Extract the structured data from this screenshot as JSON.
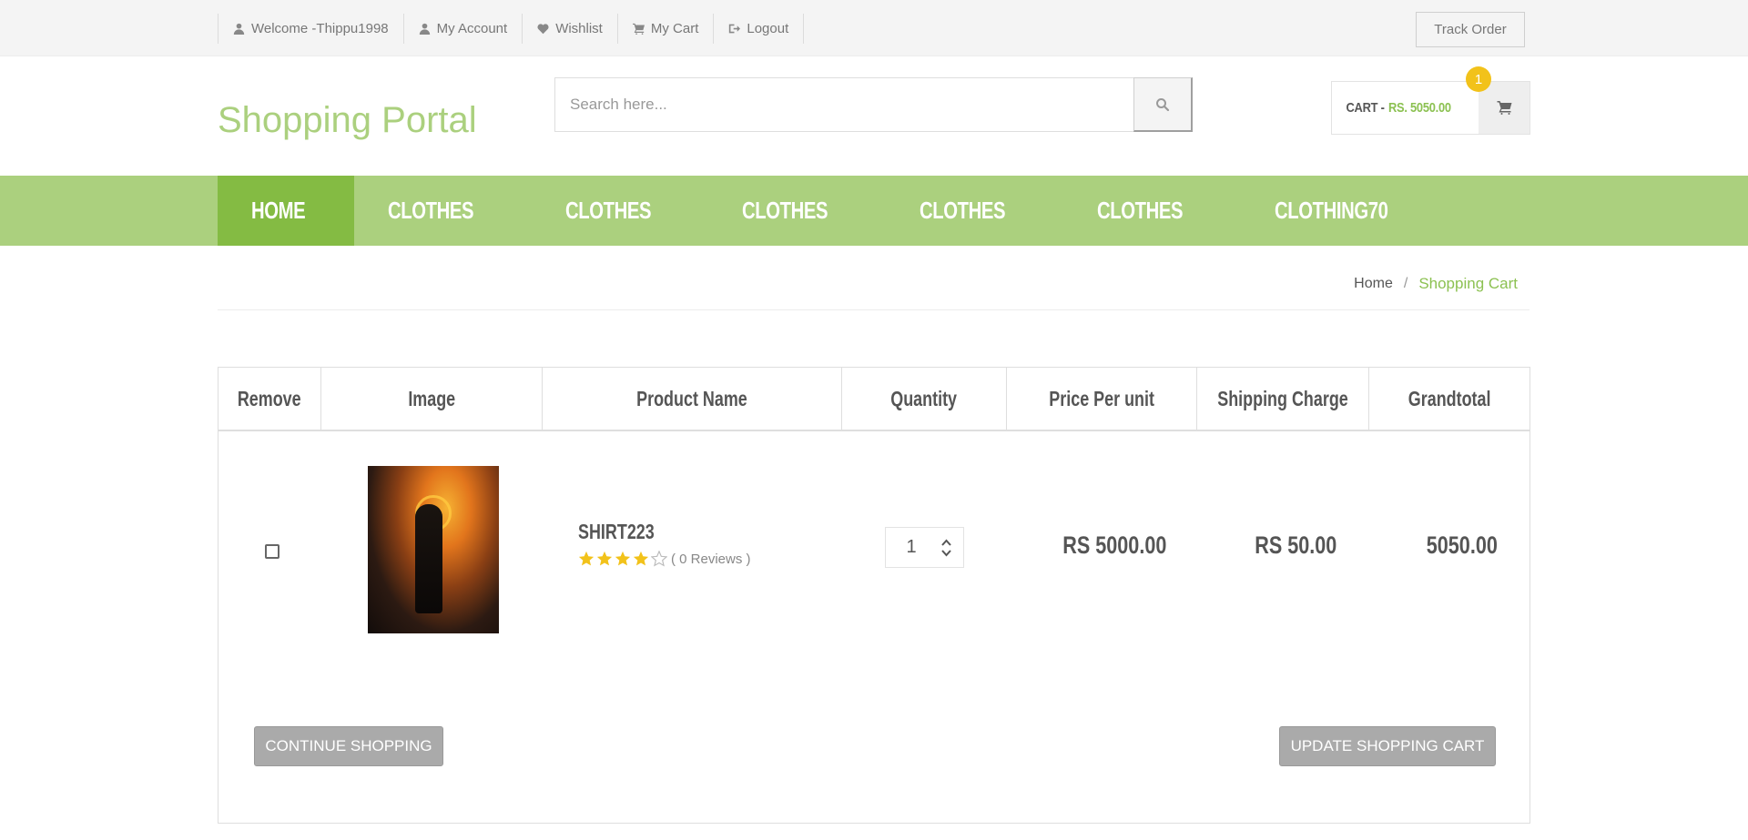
{
  "topbar": {
    "links": [
      {
        "label": "Welcome -Thippu1998",
        "icon": "user-icon"
      },
      {
        "label": "My Account",
        "icon": "user-icon"
      },
      {
        "label": "Wishlist",
        "icon": "heart-icon"
      },
      {
        "label": "My Cart",
        "icon": "cart-icon"
      },
      {
        "label": "Logout",
        "icon": "logout-icon"
      }
    ],
    "track_order": "Track Order"
  },
  "header": {
    "logo": "Shopping Portal",
    "search_placeholder": "Search here...",
    "cart_label": "CART -",
    "cart_total": "RS. 5050.00",
    "cart_count": "1"
  },
  "nav": {
    "items": [
      "HOME",
      "CLOTHES",
      "CLOTHES",
      "CLOTHES",
      "CLOTHES",
      "CLOTHES",
      "CLOTHING70"
    ],
    "active": "HOME"
  },
  "breadcrumb": {
    "home": "Home",
    "separator": "/",
    "current": "Shopping Cart"
  },
  "table": {
    "headers": [
      "Remove",
      "Image",
      "Product Name",
      "Quantity",
      "Price Per unit",
      "Shipping Charge",
      "Grandtotal"
    ],
    "rows": [
      {
        "product_name": "SHIRT223",
        "rating": 4,
        "rating_max": 5,
        "reviews": "( 0 Reviews )",
        "quantity": "1",
        "price_per_unit": "RS 5000.00",
        "shipping_charge": "RS 50.00",
        "grandtotal": "5050.00"
      }
    ]
  },
  "buttons": {
    "continue_shopping": "CONTINUE SHOPPING",
    "update_cart": "UPDATE SHOPPING CART"
  },
  "colors": {
    "brand_green": "#abd07e",
    "active_green": "#84bb43",
    "price_green": "#8cc152",
    "badge_yellow": "#f2c21a",
    "star_yellow": "#f2c21a"
  }
}
